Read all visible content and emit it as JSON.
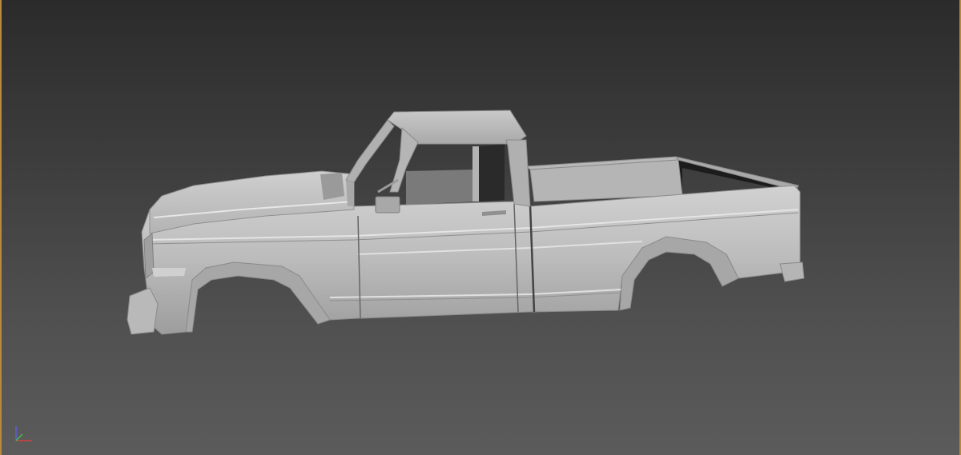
{
  "viewport": {
    "shading_mode": "shaded",
    "border_color": "#b9893c",
    "background_top": "#2b2b2b",
    "background_bottom": "#5b5b5b"
  },
  "model": {
    "icon": "pickup-truck-body-icon",
    "material_color": "#c4c4c4"
  },
  "gizmo": {
    "icon": "view-axis-tripod-icon",
    "x_axis_color": "#d04040",
    "y_axis_color": "#40c040",
    "z_axis_color": "#6060e0"
  }
}
